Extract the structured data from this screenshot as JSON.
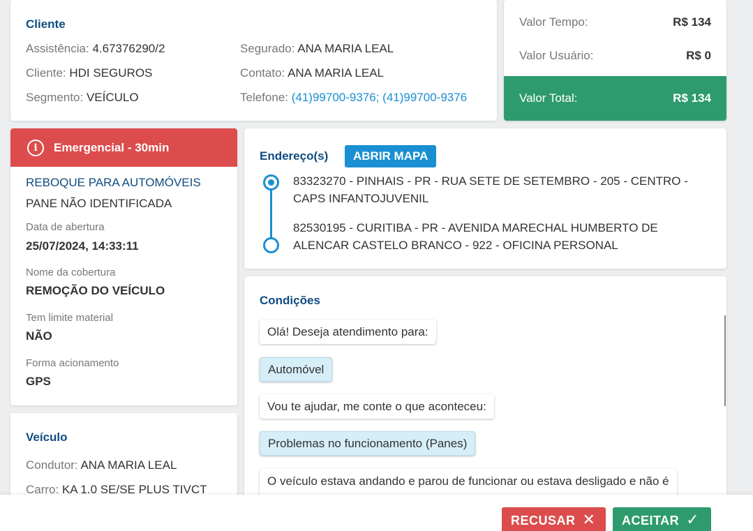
{
  "cliente": {
    "title": "Cliente",
    "assistencia_label": "Assistência:",
    "assistencia_value": "4.67376290/2",
    "cliente_label": "Cliente:",
    "cliente_value": "HDI SEGUROS",
    "segmento_label": "Segmento:",
    "segmento_value": "VEÍCULO",
    "segurado_label": "Segurado:",
    "segurado_value": "ANA MARIA LEAL",
    "contato_label": "Contato:",
    "contato_value": "ANA MARIA LEAL",
    "telefone_label": "Telefone:",
    "telefone_value": "(41)99700-9376; (41)99700-9376"
  },
  "valores": {
    "tempo_label": "Valor Tempo:",
    "tempo_value": "R$ 134",
    "usuario_label": "Valor Usuário:",
    "usuario_value": "R$ 0",
    "total_label": "Valor Total:",
    "total_value": "R$ 134"
  },
  "servico": {
    "badge": "Emergencial - 30min",
    "title": "REBOQUE PARA AUTOMÓVEIS",
    "subtitle": "PANE NÃO IDENTIFICADA",
    "data_label": "Data de abertura",
    "data_value": "25/07/2024, 14:33:11",
    "cobertura_label": "Nome da cobertura",
    "cobertura_value": "REMOÇÃO DO VEÍCULO",
    "limite_label": "Tem limite material",
    "limite_value": "NÃO",
    "acionamento_label": "Forma acionamento",
    "acionamento_value": "GPS"
  },
  "veiculo": {
    "title": "Veículo",
    "condutor_label": "Condutor:",
    "condutor_value": "ANA MARIA LEAL",
    "carro_label": "Carro:",
    "carro_value": "KA 1.0 SE/SE PLUS TIVCT"
  },
  "endereco": {
    "title": "Endereço(s)",
    "map_button": "ABRIR MAPA",
    "origem": "83323270 - PINHAIS - PR - RUA SETE DE SETEMBRO - 205 - CENTRO - CAPS INFANTOJUVENIL",
    "destino": "82530195 - CURITIBA - PR - AVENIDA MARECHAL HUMBERTO DE ALENCAR CASTELO BRANCO - 922 - OFICINA PERSONAL"
  },
  "condicoes": {
    "title": "Condições",
    "messages": [
      {
        "from": "bot",
        "text": "Olá! Deseja atendimento para:"
      },
      {
        "from": "user",
        "text": "Automóvel"
      },
      {
        "from": "bot",
        "text": "Vou te ajudar, me conte o que aconteceu:"
      },
      {
        "from": "user",
        "text": "Problemas no funcionamento (Panes)"
      },
      {
        "from": "bot",
        "text": "O veículo estava andando e parou de funcionar ou estava desligado e não é"
      }
    ]
  },
  "footer": {
    "reject_label": "RECUSAR",
    "accept_label": "ACEITAR"
  },
  "colors": {
    "primary": "#0f4c81",
    "link": "#1a8fd1",
    "danger": "#dc4c4c",
    "success": "#2e9b6e"
  }
}
